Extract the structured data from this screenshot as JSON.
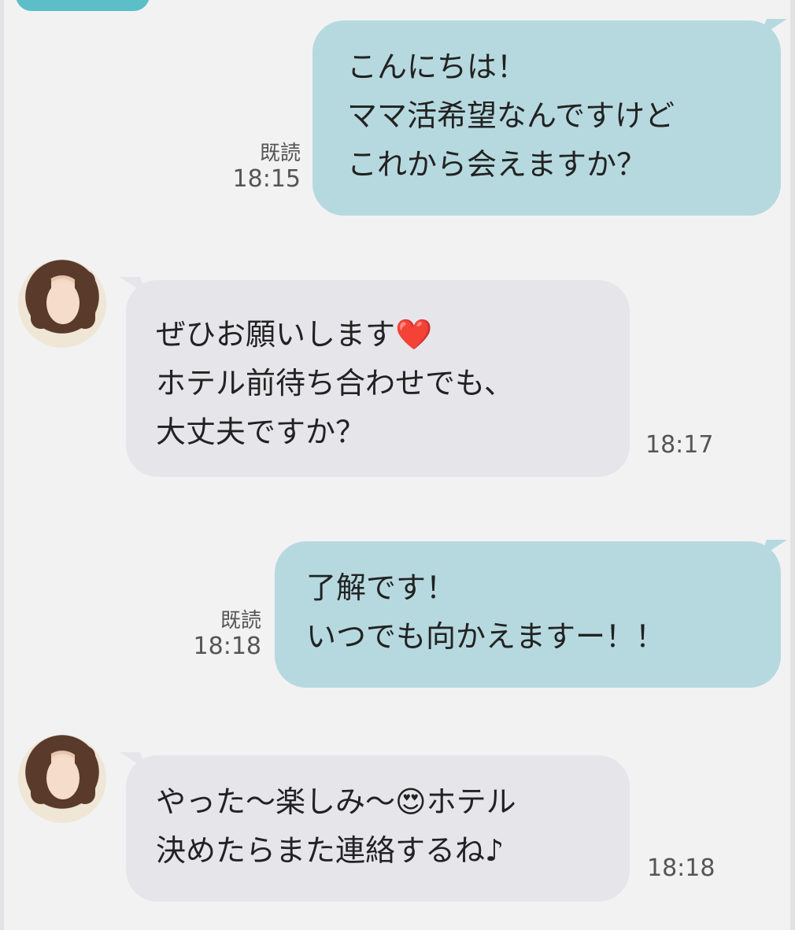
{
  "messages": [
    {
      "id": "m1",
      "side": "sent",
      "text": "こんにちは！\nママ活希望なんですけど\nこれから会えますか？",
      "read_label": "既読",
      "time": "18:15"
    },
    {
      "id": "m2",
      "side": "recv",
      "text": "ぜひお願いします❤️\nホテル前待ち合わせでも、\n大丈夫ですか？",
      "time": "18:17"
    },
    {
      "id": "m3",
      "side": "sent",
      "text": "了解です！\nいつでも向かえますー！！",
      "read_label": "既読",
      "time": "18:18"
    },
    {
      "id": "m4",
      "side": "recv",
      "text": "やった〜楽しみ〜😍ホテル\n決めたらまた連絡するね♪",
      "time": "18:18"
    }
  ],
  "colors": {
    "sent_bubble": "#b6d9df",
    "recv_bubble": "#e6e6ea",
    "background": "#f2f2f3",
    "accent": "#5cbfc8"
  },
  "icons": {
    "avatar": "contact-avatar-photo"
  }
}
